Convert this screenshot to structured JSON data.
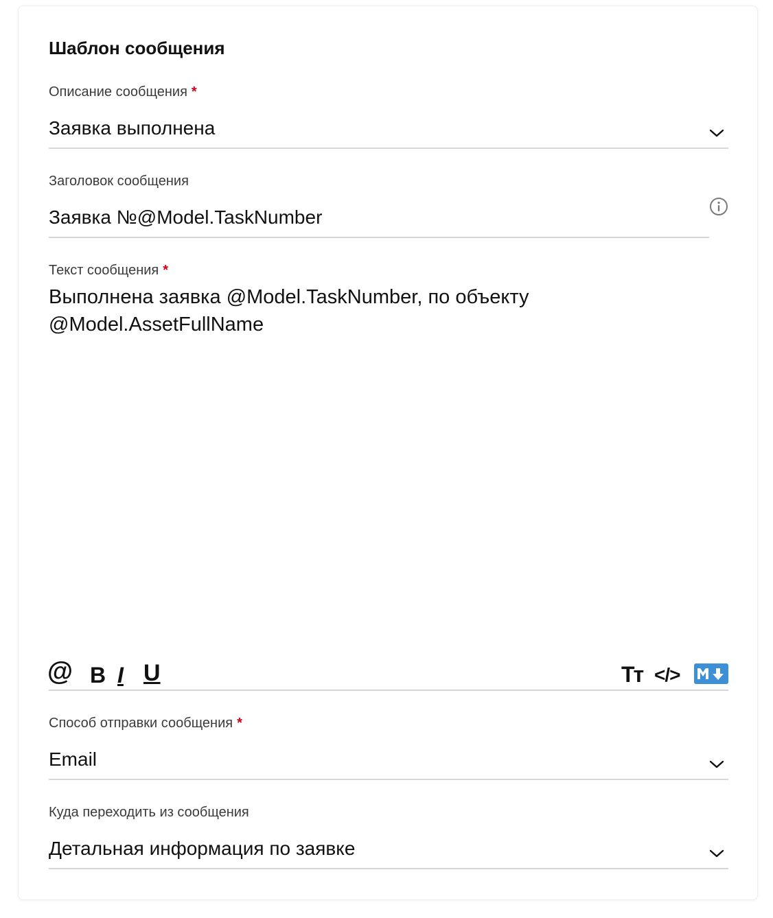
{
  "section_title": "Шаблон сообщения",
  "fields": {
    "description": {
      "label": "Описание сообщения",
      "required_mark": "*",
      "value": "Заявка выполнена"
    },
    "subject": {
      "label": "Заголовок сообщения",
      "value": "Заявка №@Model.TaskNumber"
    },
    "body": {
      "label": "Текст сообщения",
      "required_mark": "*",
      "line1": "Выполнена заявка @Model.TaskNumber, по объекту",
      "line2": "@Model.AssetFullName"
    },
    "send_method": {
      "label": "Способ отправки сообщения",
      "required_mark": "*",
      "value": "Email"
    },
    "navigate_to": {
      "label": "Куда переходить из сообщения",
      "value": "Детальная информация по заявке"
    }
  },
  "toolbar": {
    "mention": "@",
    "bold": "B",
    "italic": "I",
    "underline": "U",
    "font_size": "Тт",
    "code": "</>",
    "markdown_icon": "markdown-icon",
    "markdown_color": "#3d8fd6"
  },
  "colors": {
    "required": "#d0021b",
    "underline": "#d6d6d6"
  }
}
